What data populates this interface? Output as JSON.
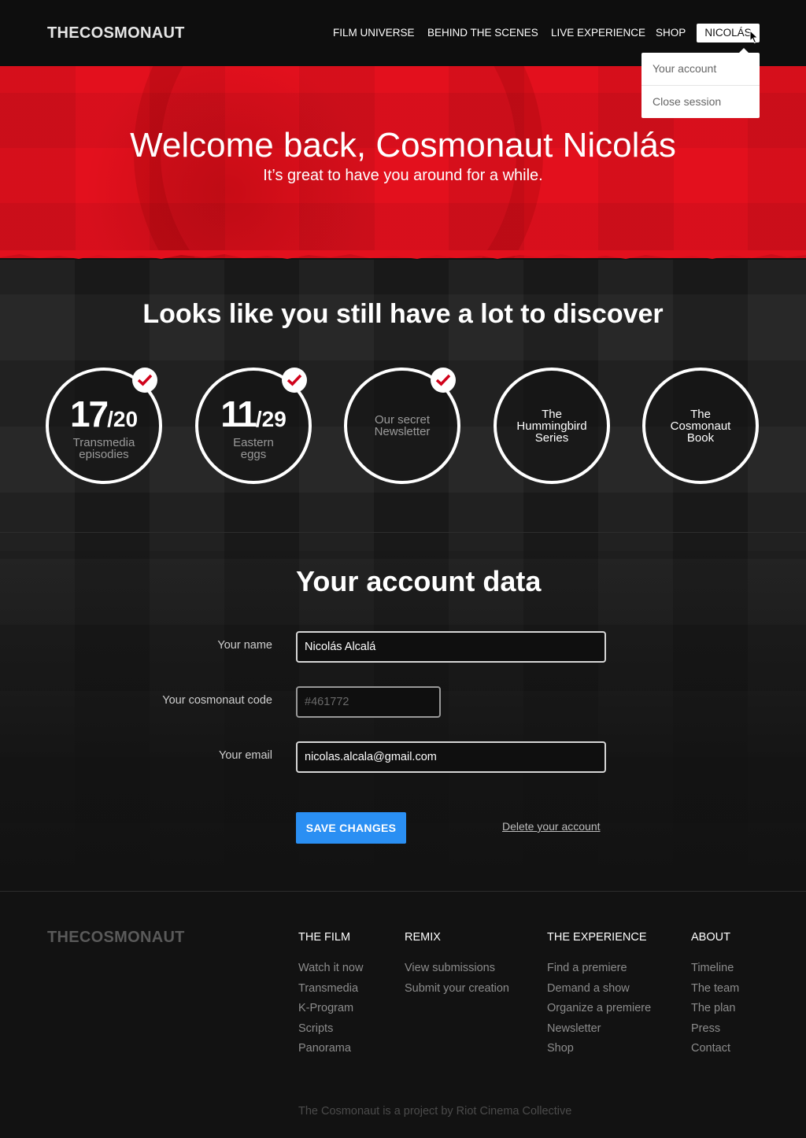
{
  "header": {
    "logo": "THECOSMONAUT",
    "nav": [
      {
        "label": "FILM UNIVERSE"
      },
      {
        "label": "BEHIND THE SCENES"
      },
      {
        "label": "LIVE EXPERIENCE"
      },
      {
        "label": "SHOP"
      }
    ],
    "user": "NICOLÁS",
    "dropdown": [
      "Your account",
      "Close session"
    ]
  },
  "hero": {
    "title": "Welcome back, Cosmonaut Nicolás",
    "subtitle": "It’s great to have you around for a while."
  },
  "discover": {
    "title": "Looks like you still have a lot to discover",
    "items": [
      {
        "num": "17",
        "den": "/20",
        "label_1": "Transmedia",
        "label_2": "episodies",
        "completed": true
      },
      {
        "num": "11",
        "den": "/29",
        "label_1": "Eastern",
        "label_2": "eggs",
        "completed": true
      },
      {
        "label_1": "Our secret",
        "label_2": "Newsletter",
        "completed": true
      },
      {
        "label_1": "The",
        "label_2": "Hummingbird",
        "label_3": "Series",
        "completed": false
      },
      {
        "label_1": "The",
        "label_2": "Cosmonaut",
        "label_3": "Book",
        "completed": false
      }
    ]
  },
  "account": {
    "title": "Your account data",
    "name_label": "Your name",
    "name_value": "Nicolás Alcalá",
    "code_label": "Your cosmonaut code",
    "code_placeholder": "#461772",
    "email_label": "Your email",
    "email_value": "nicolas.alcala@gmail.com",
    "save_label": "SAVE CHANGES",
    "delete_label": "Delete your account"
  },
  "footer": {
    "logo": "THECOSMONAUT",
    "columns": [
      {
        "title": "THE FILM",
        "links": [
          "Watch it now",
          "Transmedia",
          "K-Program",
          "Scripts",
          "Panorama"
        ]
      },
      {
        "title": "REMIX",
        "links": [
          "View submissions",
          "Submit your creation"
        ]
      },
      {
        "title": "THE EXPERIENCE",
        "links": [
          "Find a premiere",
          "Demand a show",
          "Organize a premiere",
          "Newsletter",
          "Shop"
        ]
      },
      {
        "title": "ABOUT",
        "links": [
          "Timeline",
          "The team",
          "The plan",
          "Press",
          "Contact"
        ]
      }
    ],
    "credit": "The Cosmonaut is a project by Riot Cinema Collective"
  },
  "colors": {
    "accent_red": "#e3101d",
    "button_blue": "#2a8ff3",
    "check_red": "#d0021b"
  }
}
